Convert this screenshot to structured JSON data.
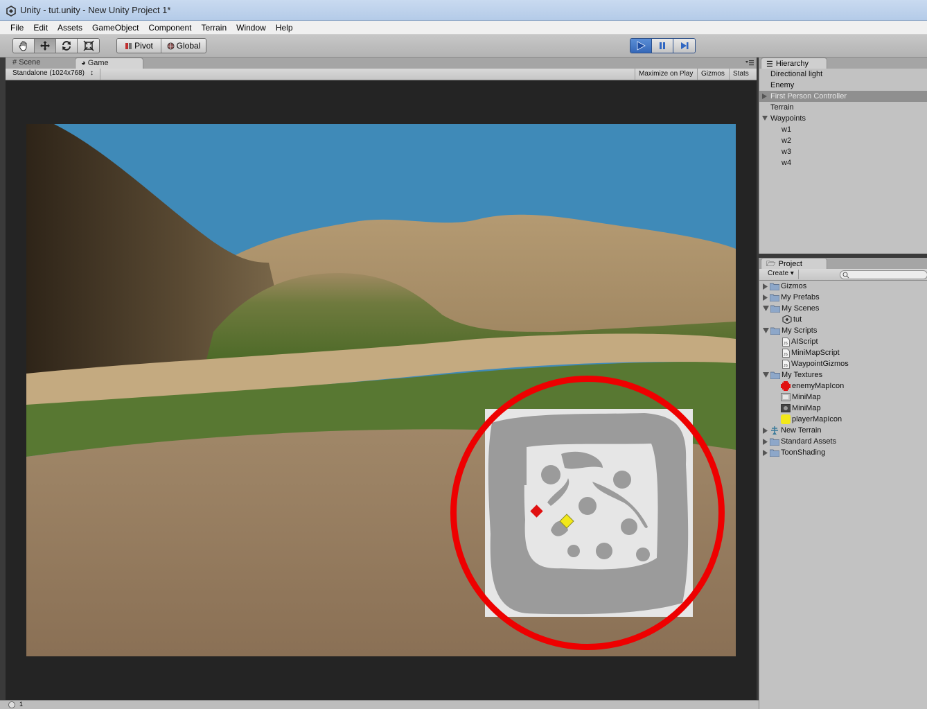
{
  "window": {
    "title": "Unity - tut.unity - New Unity Project 1*"
  },
  "menu": [
    "File",
    "Edit",
    "Assets",
    "GameObject",
    "Component",
    "Terrain",
    "Window",
    "Help"
  ],
  "toolbar": {
    "pivot_label": "Pivot",
    "global_label": "Global"
  },
  "game_panel": {
    "tabs": [
      "Scene",
      "Game"
    ],
    "resolution": "Standalone (1024x768)",
    "buttons": [
      "Maximize on Play",
      "Gizmos",
      "Stats"
    ]
  },
  "hierarchy": {
    "tab_label": "Hierarchy",
    "items": [
      "Directional light",
      "Enemy",
      "First Person Controller",
      "Terrain",
      "Waypoints",
      "w1",
      "w2",
      "w3",
      "w4"
    ]
  },
  "project": {
    "tab_label": "Project",
    "create_label": "Create",
    "items": [
      "Gizmos",
      "My Prefabs",
      "My Scenes",
      "tut",
      "My Scripts",
      "AIScript",
      "MiniMapScript",
      "WaypointGizmos",
      "My Textures",
      "enemyMapIcon",
      "MiniMap",
      "MiniMap",
      "playerMapIcon",
      "New Terrain",
      "Standard Assets",
      "ToonShading"
    ]
  },
  "status": {
    "text": "1"
  },
  "colors": {
    "sky": "#3f8ab8",
    "highlight_circle": "#ee0000",
    "enemy_marker": "#e01010",
    "player_marker": "#f2e81a",
    "play_button": "#3d74c4"
  }
}
